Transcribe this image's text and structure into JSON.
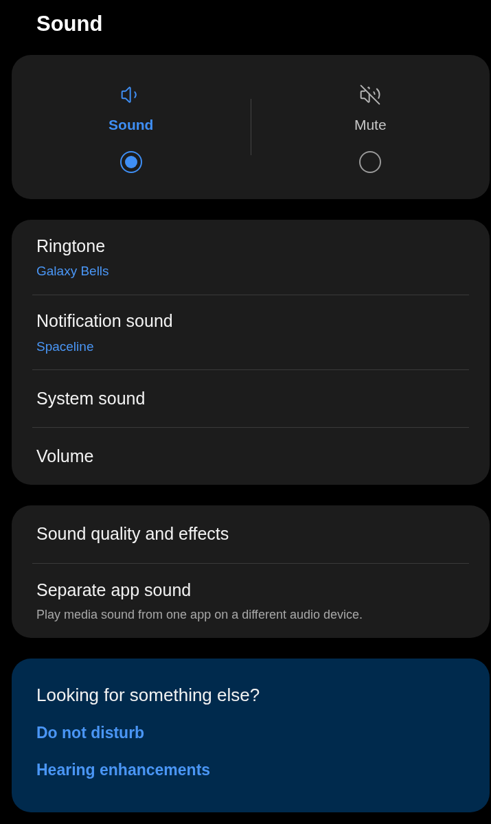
{
  "title": "Sound",
  "modes": [
    {
      "kind": "sound",
      "label": "Sound",
      "selected": true
    },
    {
      "kind": "mute",
      "label": "Mute",
      "selected": false
    }
  ],
  "groups": [
    {
      "items": [
        {
          "title": "Ringtone",
          "value": "Galaxy Bells"
        },
        {
          "title": "Notification sound",
          "value": "Spaceline"
        },
        {
          "title": "System sound"
        },
        {
          "title": "Volume"
        }
      ]
    },
    {
      "items": [
        {
          "title": "Sound quality and effects"
        },
        {
          "title": "Separate app sound",
          "description": "Play media sound from one app on a different audio device."
        }
      ]
    }
  ],
  "suggestions": {
    "heading": "Looking for something else?",
    "links": [
      "Do not disturb",
      "Hearing enhancements"
    ]
  }
}
